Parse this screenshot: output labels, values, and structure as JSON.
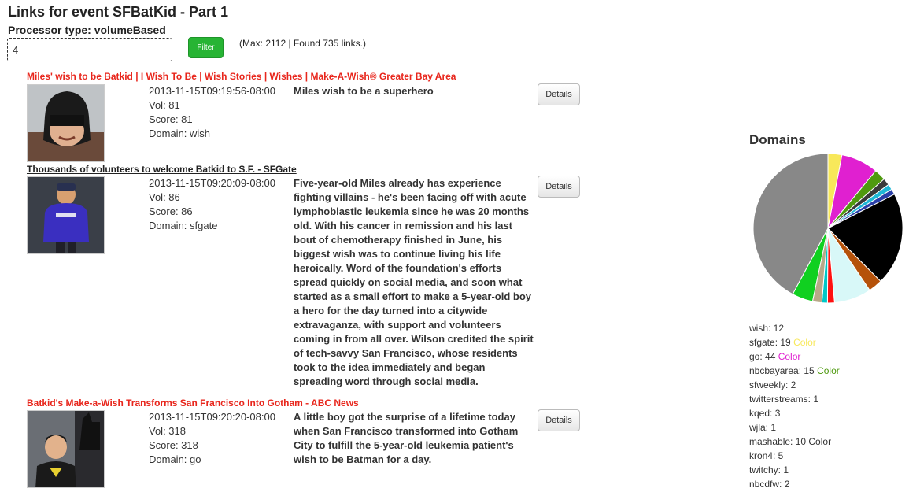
{
  "page": {
    "title": "Links for event SFBatKid - Part 1",
    "processor_type": "Processor type: volumeBased"
  },
  "filter": {
    "value": "4",
    "button_label": "Filter",
    "count_info": "(Max: 2112 | Found 735 links.)"
  },
  "links": [
    {
      "title": "Miles' wish to be Batkid | I Wish To Be | Wish Stories | Wishes | Make-A-Wish® Greater Bay Area",
      "timestamp": "2013-11-15T09:19:56-08:00",
      "vol": "Vol: 81",
      "score": "Score: 81",
      "domain": "Domain: wish",
      "description": "Miles wish to be a superhero",
      "details_label": "Details"
    },
    {
      "title": "Thousands of volunteers to welcome Batkid to S.F. - SFGate",
      "timestamp": "2013-11-15T09:20:09-08:00",
      "vol": "Vol: 86",
      "score": "Score: 86",
      "domain": "Domain: sfgate",
      "description": "Five-year-old Miles already has experience fighting villains - he's been facing off with acute lymphoblastic leukemia since he was 20 months old. With his cancer in remission and his last bout of chemotherapy finished in June, his biggest wish was to continue living his life heroically. Word of the foundation's efforts spread quickly on social media, and soon what started as a small effort to make a 5-year-old boy a hero for the day turned into a citywide extravaganza, with support and volunteers coming in from all over. Wilson credited the spirit of tech-savvy San Francisco, whose residents took to the idea immediately and began spreading word through social media.",
      "details_label": "Details"
    },
    {
      "title": "Batkid's Make-a-Wish Transforms San Francisco Into Gotham - ABC News",
      "timestamp": "2013-11-15T09:20:20-08:00",
      "vol": "Vol: 318",
      "score": "Score: 318",
      "domain": "Domain: go",
      "description": "A little boy got the surprise of a lifetime today when San Francisco transformed into Gotham City to fulfill the 5-year-old leukemia patient's wish to be Batman for a day.",
      "details_label": "Details"
    }
  ],
  "domains": {
    "title": "Domains",
    "legend": [
      {
        "label": "wish: 12",
        "color_label": "",
        "color": ""
      },
      {
        "label": "sfgate: 19",
        "color_label": "Color",
        "color": "#f8e85a"
      },
      {
        "label": "go: 44",
        "color_label": "Color",
        "color": "#e020d0"
      },
      {
        "label": "nbcbayarea: 15",
        "color_label": "Color",
        "color": "#4f9a0f"
      },
      {
        "label": "sfweekly: 2",
        "color_label": "",
        "color": ""
      },
      {
        "label": "twitterstreams: 1",
        "color_label": "",
        "color": ""
      },
      {
        "label": "kqed: 3",
        "color_label": "",
        "color": ""
      },
      {
        "label": "wjla: 1",
        "color_label": "",
        "color": ""
      },
      {
        "label": "mashable: 10",
        "color_label": "Color",
        "color": "#333333"
      },
      {
        "label": "kron4: 5",
        "color_label": "",
        "color": ""
      },
      {
        "label": "twitchy: 1",
        "color_label": "",
        "color": ""
      },
      {
        "label": "nbcdfw: 2",
        "color_label": "",
        "color": ""
      }
    ],
    "pie_slices": [
      {
        "value": 3,
        "color": "#f8e85a"
      },
      {
        "value": 8,
        "color": "#e020d0"
      },
      {
        "value": 2.5,
        "color": "#4f9a0f"
      },
      {
        "value": 1.5,
        "color": "#3a3a3a"
      },
      {
        "value": 1.2,
        "color": "#1fb7d6"
      },
      {
        "value": 1.2,
        "color": "#2a3fa8"
      },
      {
        "value": 20,
        "color": "#000000"
      },
      {
        "value": 3,
        "color": "#b5520a"
      },
      {
        "value": 8,
        "color": "#d8f8f8"
      },
      {
        "value": 1.5,
        "color": "#ff1010"
      },
      {
        "value": 1.2,
        "color": "#00c8c8"
      },
      {
        "value": 2,
        "color": "#b8a888"
      },
      {
        "value": 4.5,
        "color": "#10d020"
      },
      {
        "value": 42,
        "color": "#888888"
      }
    ]
  }
}
